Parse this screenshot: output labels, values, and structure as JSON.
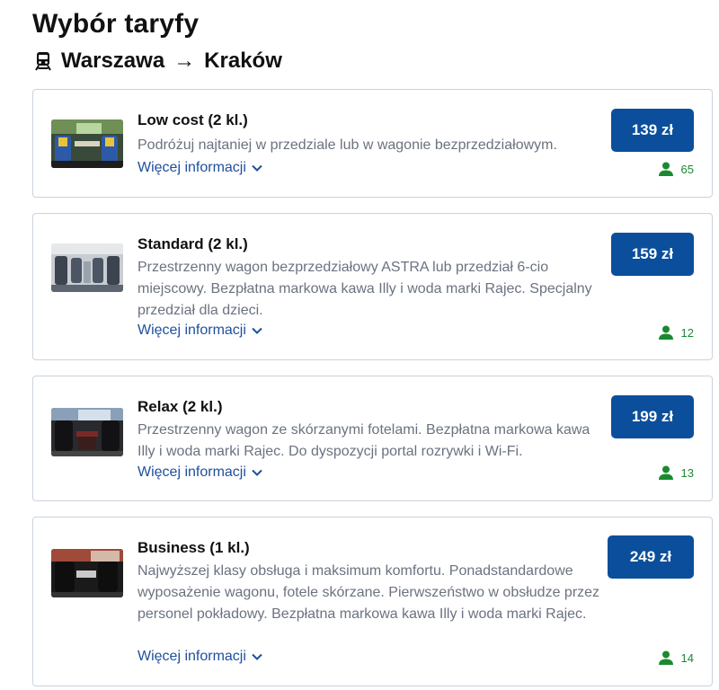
{
  "page": {
    "title": "Wybór taryfy"
  },
  "route": {
    "from": "Warszawa",
    "arrow": "→",
    "to": "Kraków",
    "icon": "train-icon"
  },
  "fares": [
    {
      "name": "Low cost (2 kl.)",
      "description": "Podróżuj najtaniej w przedziale lub w wagonie bezprzedziałowym.",
      "more": "Więcej informacji",
      "price": "139 zł",
      "seats": "65"
    },
    {
      "name": "Standard (2 kl.)",
      "description": "Przestrzenny wagon bezprzedziałowy ASTRA lub przedział 6-cio miejscowy. Bezpłatna markowa kawa Illy i woda marki Rajec. Specjalny przedział dla dzieci.",
      "more": "Więcej informacji",
      "price": "159 zł",
      "seats": "12"
    },
    {
      "name": "Relax (2 kl.)",
      "description": "Przestrzenny wagon ze skórzanymi fotelami. Bezpłatna markowa kawa Illy i woda marki Rajec. Do dyspozycji portal rozrywki i Wi-Fi.",
      "more": "Więcej informacji",
      "price": "199 zł",
      "seats": "13"
    },
    {
      "name": "Business (1 kl.)",
      "description": "Najwyższej klasy obsługa i maksimum komfortu. Ponadstandardowe wyposażenie wagonu, fotele skórzane. Pierwszeństwo w obsłudze przez personel pokładowy. Bezpłatna markowa kawa Illy i woda marki Rajec.",
      "more": "Więcej informacji",
      "price": "249 zł",
      "seats": "14"
    }
  ],
  "colors": {
    "accent": "#0b4f9c",
    "link": "#1e4f9c",
    "availability": "#1a8a2e",
    "text_muted": "#6b7280",
    "border": "#c9d3dc"
  }
}
